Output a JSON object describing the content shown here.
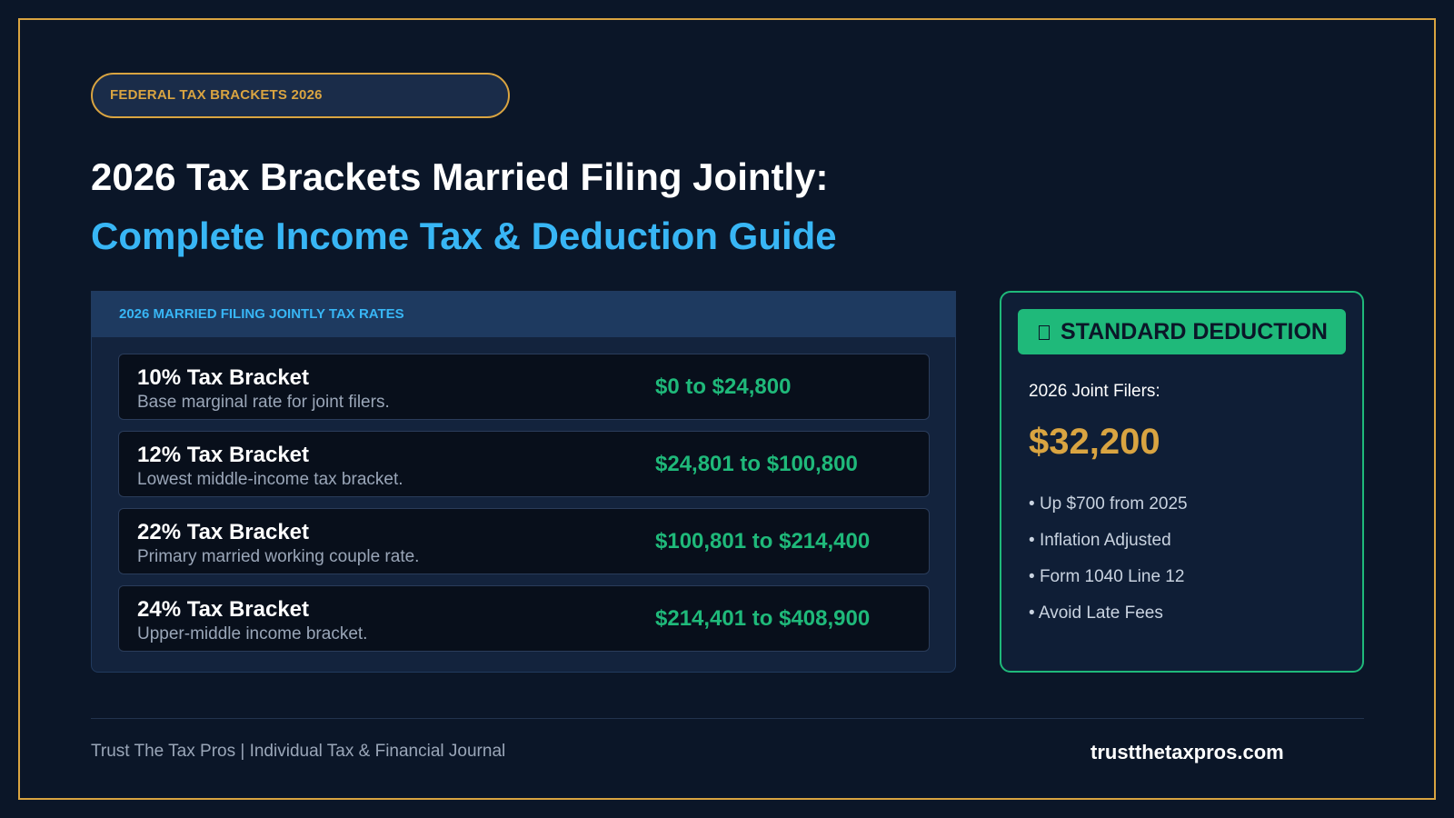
{
  "badge": "FEDERAL TAX BRACKETS 2026",
  "title_line1": "2026 Tax Brackets Married Filing Jointly:",
  "title_line2": "Complete Income Tax & Deduction Guide",
  "rates_panel": {
    "header": "2026 MARRIED FILING JOINTLY TAX RATES",
    "brackets": [
      {
        "name": "10% Tax Bracket",
        "description": "Base marginal rate for joint filers.",
        "range": "$0 to $24,800"
      },
      {
        "name": "12% Tax Bracket",
        "description": "Lowest middle-income tax bracket.",
        "range": "$24,801 to $100,800"
      },
      {
        "name": "22% Tax Bracket",
        "description": "Primary married working couple rate.",
        "range": "$100,801 to $214,400"
      },
      {
        "name": "24% Tax Bracket",
        "description": "Upper-middle income bracket.",
        "range": "$214,401 to $408,900"
      }
    ]
  },
  "deduction": {
    "icon": "document-icon",
    "heading": "STANDARD DEDUCTION",
    "subtitle": "2026 Joint Filers:",
    "amount": "$32,200",
    "items": [
      "Up $700 from 2025",
      "Inflation Adjusted",
      "Form 1040 Line 12",
      "Avoid Late Fees"
    ]
  },
  "footer": {
    "left": "Trust The Tax Pros | Individual Tax & Financial Journal",
    "right": "trustthetaxpros.com"
  },
  "colors": {
    "background": "#0b1628",
    "gold": "#d9a441",
    "blue": "#38b6f5",
    "green": "#1fb97a"
  }
}
